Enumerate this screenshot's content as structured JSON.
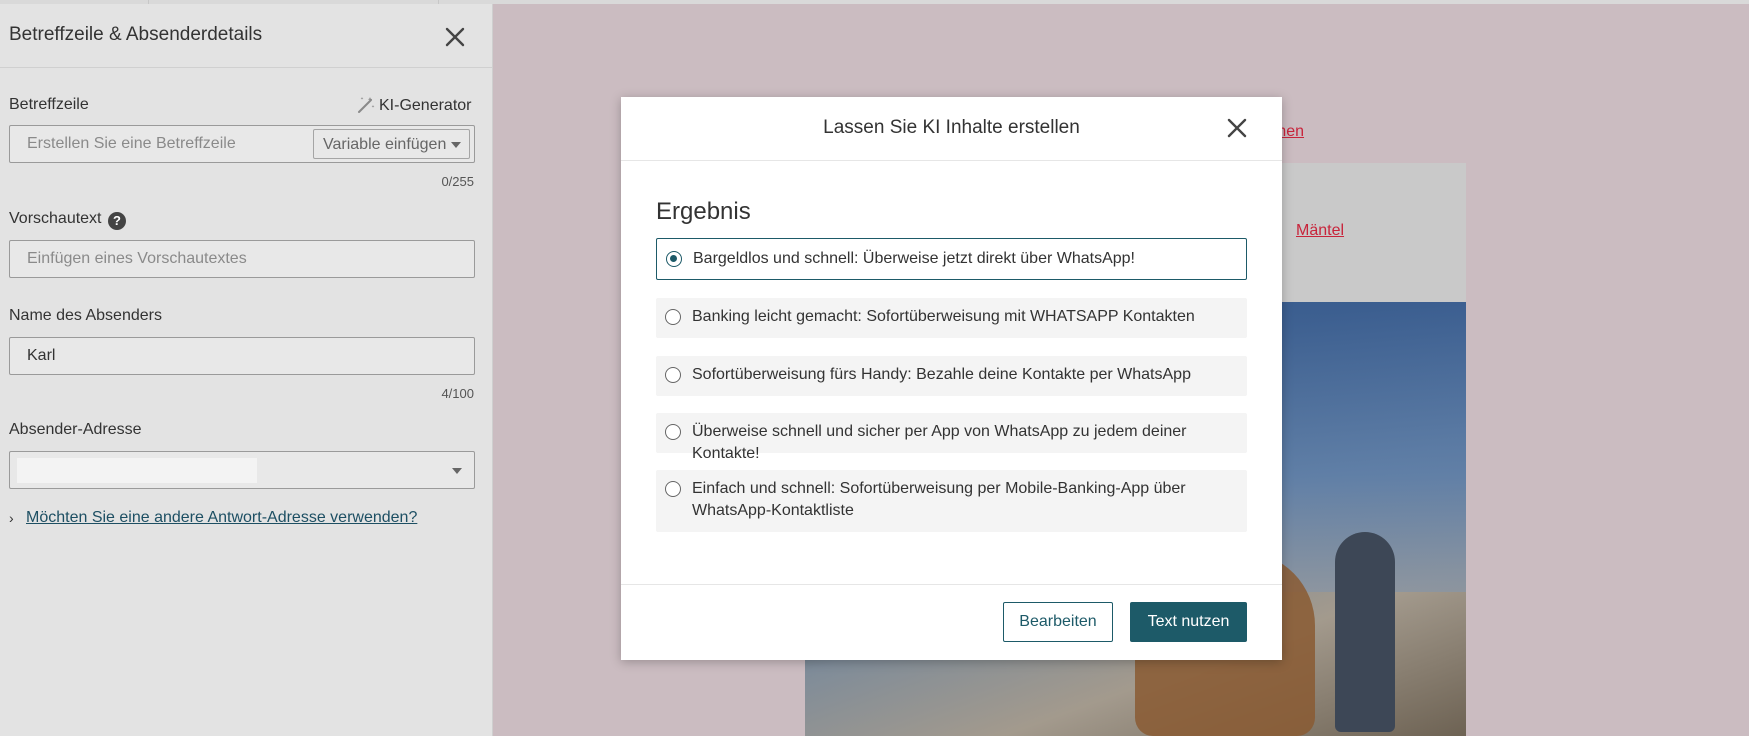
{
  "panel": {
    "title": "Betreffzeile & Absenderdetails",
    "subject": {
      "label": "Betreffzeile",
      "ai_generator": "KI-Generator",
      "placeholder": "Erstellen Sie eine Betreffzeile",
      "variable_button": "Variable einfügen",
      "counter": "0/255"
    },
    "preview": {
      "label": "Vorschautext",
      "help": "?",
      "placeholder": "Einfügen eines Vorschautextes"
    },
    "sender_name": {
      "label": "Name des Absenders",
      "value": "Karl",
      "counter": "4/100"
    },
    "sender_address": {
      "label": "Absender-Adresse"
    },
    "reply_link": "Möchten Sie eine andere Antwort-Adresse verwenden?"
  },
  "background": {
    "link1": "hmen",
    "link2": "Mäntel"
  },
  "modal": {
    "title": "Lassen Sie KI Inhalte erstellen",
    "section_title": "Ergebnis",
    "options": [
      {
        "text": "Bargeldlos und schnell: Überweise jetzt direkt über WhatsApp!",
        "selected": true
      },
      {
        "text": "Banking leicht gemacht: Sofortüberweisung mit WHATSAPP Kontakten",
        "selected": false
      },
      {
        "text": "Sofortüberweisung fürs Handy: Bezahle deine Kontakte per WhatsApp",
        "selected": false
      },
      {
        "text": "Überweise schnell und sicher per App von WhatsApp zu jedem deiner Kontakte!",
        "selected": false
      },
      {
        "text": "Einfach und schnell: Sofortüberweisung per Mobile-Banking-App über WhatsApp-Kontaktliste",
        "selected": false
      }
    ],
    "edit_button": "Bearbeiten",
    "use_button": "Text nutzen"
  },
  "colors": {
    "accent": "#1d5a68",
    "link_red": "#c8243b",
    "overlay": "#cbbcc1"
  }
}
